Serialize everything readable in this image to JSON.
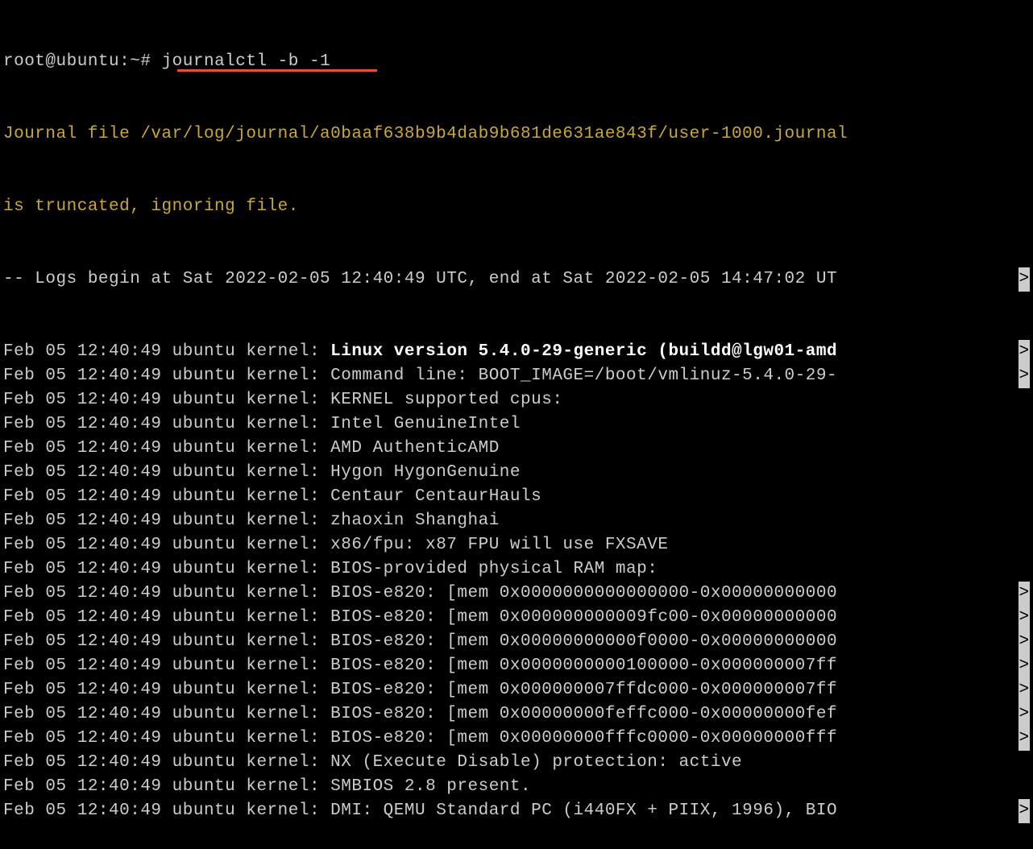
{
  "prompt": {
    "user_host": "root@ubuntu",
    "path": "~",
    "symbol": "#",
    "command": "journalctl -b -1"
  },
  "warning": "Journal file /var/log/journal/a0baaf638b9b4dab9b681de631ae843f/user-1000.journal is truncated, ignoring file.",
  "header": "-- Logs begin at Sat 2022-02-05 12:40:49 UTC, end at Sat 2022-02-05 14:47:02 UT",
  "truncate_char": ">",
  "log_prefix": "Feb 05 12:40:49 ubuntu kernel:",
  "lines": [
    {
      "msg": "Linux version 5.4.0-29-generic (buildd@lgw01-amd",
      "bold": true,
      "truncated": true
    },
    {
      "msg": "Command line: BOOT_IMAGE=/boot/vmlinuz-5.4.0-29-",
      "truncated": true
    },
    {
      "msg": "KERNEL supported cpus:",
      "truncated": false
    },
    {
      "msg": "  Intel GenuineIntel",
      "truncated": false
    },
    {
      "msg": "  AMD AuthenticAMD",
      "truncated": false
    },
    {
      "msg": "  Hygon HygonGenuine",
      "truncated": false
    },
    {
      "msg": "  Centaur CentaurHauls",
      "truncated": false
    },
    {
      "msg": "  zhaoxin   Shanghai",
      "truncated": false
    },
    {
      "msg": "x86/fpu: x87 FPU will use FXSAVE",
      "truncated": false
    },
    {
      "msg": "BIOS-provided physical RAM map:",
      "truncated": false
    },
    {
      "msg": "BIOS-e820: [mem 0x0000000000000000-0x00000000000",
      "truncated": true
    },
    {
      "msg": "BIOS-e820: [mem 0x000000000009fc00-0x00000000000",
      "truncated": true
    },
    {
      "msg": "BIOS-e820: [mem 0x00000000000f0000-0x00000000000",
      "truncated": true
    },
    {
      "msg": "BIOS-e820: [mem 0x0000000000100000-0x000000007ff",
      "truncated": true
    },
    {
      "msg": "BIOS-e820: [mem 0x000000007ffdc000-0x000000007ff",
      "truncated": true
    },
    {
      "msg": "BIOS-e820: [mem 0x00000000feffc000-0x00000000fef",
      "truncated": true
    },
    {
      "msg": "BIOS-e820: [mem 0x00000000fffc0000-0x00000000fff",
      "truncated": true
    },
    {
      "msg": "NX (Execute Disable) protection: active",
      "truncated": false
    },
    {
      "msg": "SMBIOS 2.8 present.",
      "truncated": false
    },
    {
      "msg": "DMI: QEMU Standard PC (i440FX + PIIX, 1996), BIO",
      "truncated": true
    }
  ]
}
